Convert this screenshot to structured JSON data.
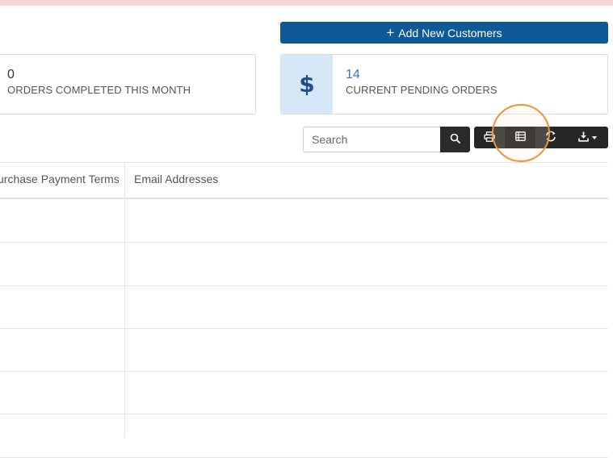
{
  "header": {
    "add_button_icon": "plus-icon",
    "add_button_label": "Add New Customers",
    "accent_color": "#0e5a96"
  },
  "stats": {
    "completed": {
      "value": "0",
      "label": "ORDERS COMPLETED THIS MONTH"
    },
    "pending": {
      "value": "14",
      "label": "CURRENT PENDING ORDERS",
      "icon": "dollar-icon",
      "icon_text": "$"
    }
  },
  "search": {
    "placeholder": "Search",
    "icon": "search-icon"
  },
  "toolbar": {
    "buttons": [
      {
        "icon": "print-icon"
      },
      {
        "icon": "columns-icon",
        "highlighted": true
      },
      {
        "icon": "refresh-icon"
      },
      {
        "icon": "download-icon",
        "has_dropdown": true
      }
    ]
  },
  "table": {
    "columns": [
      "urchase Payment Terms",
      "Email Addresses"
    ],
    "rows": [
      [
        "",
        ""
      ],
      [
        "",
        ""
      ],
      [
        "",
        ""
      ],
      [
        "",
        ""
      ],
      [
        "",
        ""
      ],
      [
        "",
        ""
      ]
    ]
  }
}
